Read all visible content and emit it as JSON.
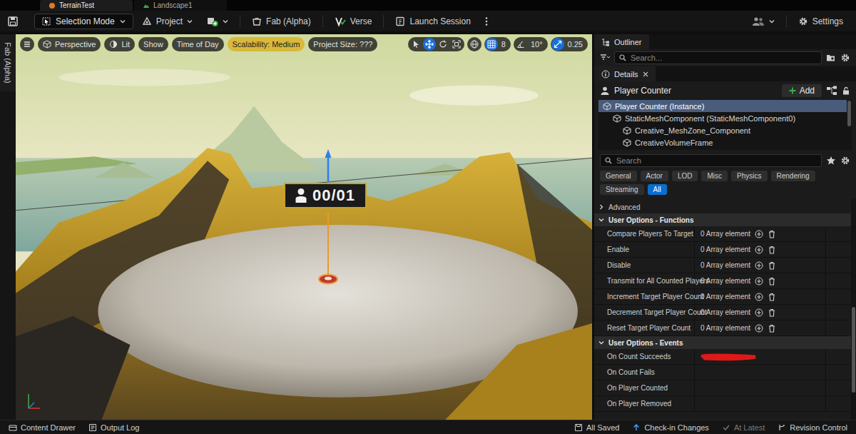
{
  "document_tabs": [
    {
      "label": "TerrainTest",
      "selected": true
    },
    {
      "label": "Landscape1",
      "selected": false
    }
  ],
  "toolbar": {
    "mode": "Selection Mode",
    "items": [
      "Project",
      "Fab (Alpha)",
      "Verse",
      "Launch Session"
    ],
    "settings": "Settings"
  },
  "side_tab": "Fab (Alpha)",
  "viewport": {
    "buttons": [
      {
        "label": "Perspective",
        "highlight": false
      },
      {
        "label": "Lit",
        "highlight": false
      },
      {
        "label": "Show",
        "highlight": false
      },
      {
        "label": "Time of Day",
        "highlight": false
      },
      {
        "label": "Scalability: Medium",
        "highlight": true
      },
      {
        "label": "Project Size: ???",
        "highlight": false
      }
    ],
    "transform_tools": [
      {
        "selected": false
      },
      {
        "selected": true
      },
      {
        "selected": false
      },
      {
        "selected": false
      }
    ],
    "snaps": [
      {
        "value": "8",
        "active": true
      },
      {
        "value": "10°",
        "active": false
      },
      {
        "value": "0.25",
        "active": true
      }
    ],
    "billboard": "00/01"
  },
  "outliner": {
    "title": "Outliner",
    "search_placeholder": "Search..."
  },
  "details": {
    "title": "Details",
    "object": "Player Counter",
    "add_button": "Add",
    "components": [
      {
        "label": "Player Counter (Instance)",
        "selected": true,
        "depth": 0
      },
      {
        "label": "StaticMeshComponent (StaticMeshComponent0)",
        "selected": false,
        "depth": 1
      },
      {
        "label": "Creative_MeshZone_Component",
        "selected": false,
        "depth": 2
      },
      {
        "label": "CreativeVolumeFrame",
        "selected": false,
        "depth": 2
      }
    ],
    "search_placeholder": "Search",
    "filters": [
      {
        "label": "General",
        "selected": false
      },
      {
        "label": "Actor",
        "selected": false
      },
      {
        "label": "LOD",
        "selected": false
      },
      {
        "label": "Misc",
        "selected": false
      },
      {
        "label": "Physics",
        "selected": false
      },
      {
        "label": "Rendering",
        "selected": false
      },
      {
        "label": "Streaming",
        "selected": false
      },
      {
        "label": "All",
        "selected": true
      }
    ],
    "advanced": {
      "label": "Advanced",
      "expanded": false
    },
    "sections": [
      {
        "title": "User Options - Functions",
        "expanded": true,
        "rows": [
          {
            "name": "Compare Players To Target",
            "kind": "array",
            "value": "0 Array element"
          },
          {
            "name": "Enable",
            "kind": "array",
            "value": "0 Array element"
          },
          {
            "name": "Disable",
            "kind": "array",
            "value": "0 Array element"
          },
          {
            "name": "Transmit for All Counted Players",
            "kind": "array",
            "value": "0 Array element"
          },
          {
            "name": "Increment Target Player Count",
            "kind": "array",
            "value": "0 Array element"
          },
          {
            "name": "Decrement Target Player Count",
            "kind": "array",
            "value": "0 Array element"
          },
          {
            "name": "Reset Target Player Count",
            "kind": "array",
            "value": "0 Array element"
          }
        ]
      },
      {
        "title": "User Options - Events",
        "expanded": true,
        "rows": [
          {
            "name": "On Count Succeeds",
            "kind": "event",
            "marked": true
          },
          {
            "name": "On Count Fails",
            "kind": "event",
            "marked": false
          },
          {
            "name": "On Player Counted",
            "kind": "event",
            "marked": false
          },
          {
            "name": "On Player Removed",
            "kind": "event",
            "marked": false
          }
        ]
      }
    ]
  },
  "status_bar": {
    "left": [
      "Content Drawer",
      "Output Log"
    ],
    "right": [
      {
        "label": "All Saved",
        "disabled": false
      },
      {
        "label": "Check-in Changes",
        "disabled": false
      },
      {
        "label": "At Latest",
        "disabled": true
      },
      {
        "label": "Revision Control",
        "disabled": false
      }
    ]
  }
}
